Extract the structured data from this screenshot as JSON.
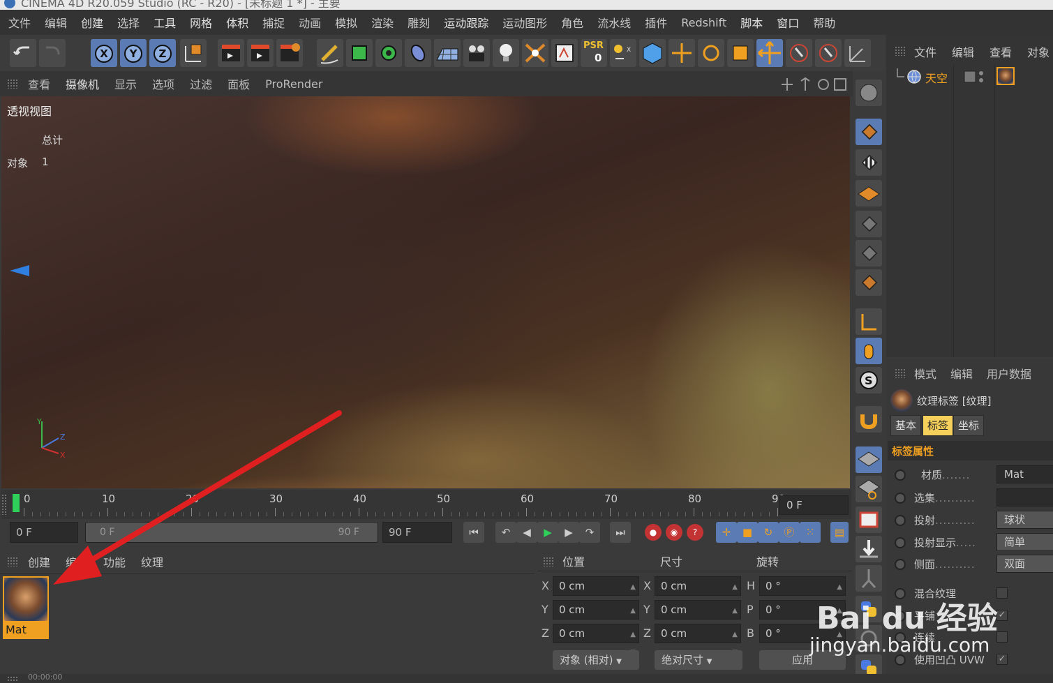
{
  "title": "CINEMA 4D R20.059 Studio (RC - R20) - [未标题 1 *] - 主要",
  "main_menu": [
    "文件",
    "编辑",
    "创建",
    "选择",
    "工具",
    "网格",
    "体积",
    "捕捉",
    "动画",
    "模拟",
    "渲染",
    "雕刻",
    "运动跟踪",
    "运动图形",
    "角色",
    "流水线",
    "插件",
    "Redshift",
    "脚本",
    "窗口",
    "帮助"
  ],
  "toolbar": {
    "axis_x": "X",
    "axis_y": "Y",
    "axis_z": "Z",
    "psr_label": "PSR",
    "psr_value": "0"
  },
  "viewport_menu": [
    "查看",
    "摄像机",
    "显示",
    "选项",
    "过滤",
    "面板",
    "ProRender"
  ],
  "viewport": {
    "label": "透视视图",
    "total_label": "总计",
    "objects_label": "对象",
    "objects_count": "1"
  },
  "object_manager": {
    "menu": [
      "文件",
      "编辑",
      "查看",
      "对象"
    ],
    "objects": [
      {
        "name": "天空"
      }
    ]
  },
  "attribute_manager": {
    "menu": [
      "模式",
      "编辑",
      "用户数据"
    ],
    "title": "纹理标签 [纹理]",
    "tabs": [
      {
        "label": "基本",
        "active": false
      },
      {
        "label": "标签",
        "active": true
      },
      {
        "label": "坐标",
        "active": false
      }
    ],
    "section": "标签属性",
    "properties": [
      {
        "label": "材质",
        "value": "Mat",
        "kind": "link"
      },
      {
        "label": "选集",
        "value": "",
        "kind": "field"
      },
      {
        "label": "投射",
        "value": "球状",
        "kind": "dropdown"
      },
      {
        "label": "投射显示",
        "value": "简单",
        "kind": "dropdown"
      },
      {
        "label": "侧面",
        "value": "双面",
        "kind": "dropdown"
      },
      {
        "label": "混合纹理",
        "value": "",
        "kind": "check",
        "checked": false
      },
      {
        "label": "平铺",
        "value": "",
        "kind": "check",
        "checked": true
      },
      {
        "label": "连续",
        "value": "",
        "kind": "check",
        "checked": false
      },
      {
        "label": "使用凹凸 UVW",
        "value": "",
        "kind": "check",
        "checked": true
      }
    ]
  },
  "timeline": {
    "ticks": [
      "0",
      "10",
      "20",
      "30",
      "40",
      "50",
      "60",
      "70",
      "80",
      "90"
    ],
    "current_frame": "0 F"
  },
  "transport": {
    "start_field": "0 F",
    "range_start": "0 F",
    "range_end": "90 F",
    "end_field": "90 F"
  },
  "material_manager": {
    "menu": [
      "创建",
      "编辑",
      "功能",
      "纹理"
    ],
    "materials": [
      {
        "name": "Mat"
      }
    ]
  },
  "coordinates": {
    "headers": [
      "位置",
      "尺寸",
      "旋转"
    ],
    "position": [
      {
        "axis": "X",
        "value": "0 cm"
      },
      {
        "axis": "Y",
        "value": "0 cm"
      },
      {
        "axis": "Z",
        "value": "0 cm"
      }
    ],
    "size": [
      {
        "axis": "X",
        "value": "0 cm"
      },
      {
        "axis": "Y",
        "value": "0 cm"
      },
      {
        "axis": "Z",
        "value": "0 cm"
      }
    ],
    "rotation": [
      {
        "axis": "H",
        "value": "0 °"
      },
      {
        "axis": "P",
        "value": "0 °"
      },
      {
        "axis": "B",
        "value": "0 °"
      }
    ],
    "mode_dropdown": "对象 (相对)",
    "size_dropdown": "绝对尺寸",
    "apply_button": "应用"
  },
  "status_bar": "00:00:00",
  "watermark": {
    "brand": "Bai du 经验",
    "url": "jingyan.baidu.com"
  },
  "colors": {
    "accent_orange": "#f0a020",
    "axis_blue": "#5a7bb3",
    "arrow_red": "#e02020",
    "playhead_green": "#2fd05a"
  }
}
